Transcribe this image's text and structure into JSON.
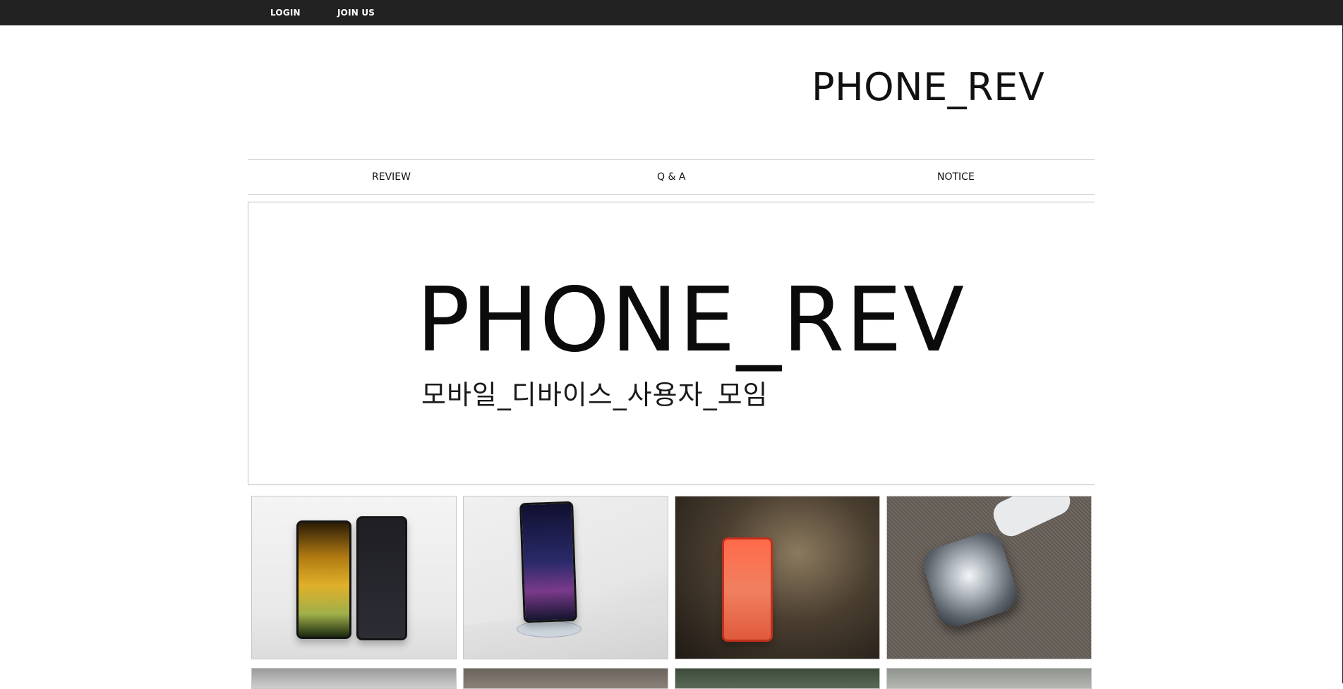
{
  "topbar": {
    "login_label": "LOGIN",
    "join_label": "JOIN US"
  },
  "header": {
    "site_title": "PHONE_REV"
  },
  "nav": {
    "items": [
      {
        "label": "REVIEW"
      },
      {
        "label": "Q & A"
      },
      {
        "label": "NOTICE"
      }
    ]
  },
  "banner": {
    "title": "PHONE_REV",
    "subtitle": "모바일_디바이스_사용자_모임"
  },
  "gallery": {
    "tiles": [
      {
        "depicts": "two-smartphones"
      },
      {
        "depicts": "lg-phone-on-stand"
      },
      {
        "depicts": "red-iphone"
      },
      {
        "depicts": "smartwatch"
      }
    ]
  },
  "colors": {
    "topbar_bg": "#222222",
    "topbar_text": "#ffffff",
    "nav_border": "#cfcfcf"
  }
}
